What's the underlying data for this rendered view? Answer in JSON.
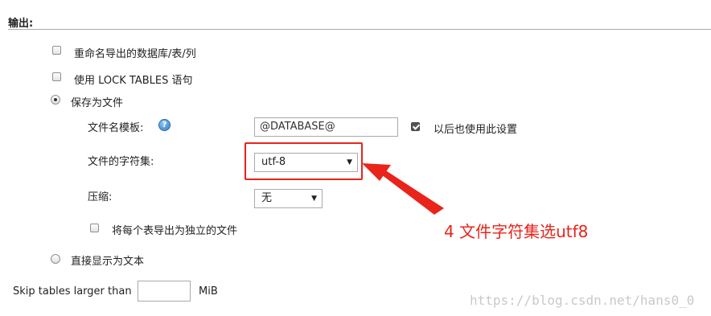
{
  "section": {
    "title": "输出:"
  },
  "options": {
    "rename_export": {
      "label": "重命名导出的数据库/表/列",
      "checked": false
    },
    "lock_tables": {
      "label": "使用 LOCK TABLES 语句",
      "checked": false
    },
    "save_as_file": {
      "label": "保存为文件",
      "checked": true
    },
    "show_as_text": {
      "label": "直接显示为文本",
      "checked": false
    }
  },
  "file_settings": {
    "template_label": "文件名模板:",
    "help_icon": "question-help-icon",
    "template_value": "@DATABASE@",
    "remember_label": "以后也使用此设置",
    "remember_checked": true,
    "charset_label": "文件的字符集:",
    "charset_value": "utf-8",
    "compression_label": "压缩:",
    "compression_value": "无",
    "separate_files_label": "将每个表导出为独立的文件",
    "separate_files_checked": false
  },
  "skip_tables": {
    "label": "Skip tables larger than",
    "value": "",
    "unit": "MiB"
  },
  "annotation": {
    "text": "4 文件字符集选utf8",
    "color": "#e8241b"
  },
  "watermark": {
    "text": "https://blog.csdn.net/hans0_0"
  }
}
